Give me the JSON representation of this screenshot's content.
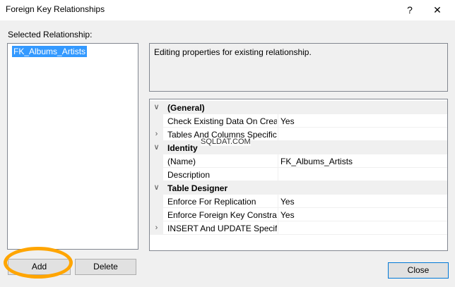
{
  "window": {
    "title": "Foreign Key Relationships",
    "help_label": "?",
    "close_glyph": "✕"
  },
  "relationships": {
    "label": "Selected Relationship:",
    "items": [
      "FK_Albums_Artists"
    ]
  },
  "description": "Editing properties for existing relationship.",
  "properties": {
    "general": {
      "label": "(General)",
      "check_existing": {
        "name": "Check Existing Data On Creati",
        "value": "Yes"
      },
      "tables_columns": {
        "name": "Tables And Columns Specifica",
        "value": ""
      }
    },
    "identity": {
      "label": "Identity",
      "name_prop": {
        "name": "(Name)",
        "value": "FK_Albums_Artists"
      },
      "description_prop": {
        "name": "Description",
        "value": ""
      }
    },
    "table_designer": {
      "label": "Table Designer",
      "enforce_replication": {
        "name": "Enforce For Replication",
        "value": "Yes"
      },
      "enforce_fk": {
        "name": "Enforce Foreign Key Constrair",
        "value": "Yes"
      },
      "insert_update": {
        "name": "INSERT And UPDATE Specifica",
        "value": ""
      }
    }
  },
  "watermark": "SQLDAT.COM",
  "buttons": {
    "add": "Add",
    "delete": "Delete",
    "close": "Close"
  },
  "icons": {
    "expanded": "chevron-down-icon",
    "collapsed": "chevron-right-icon"
  },
  "colors": {
    "selection": "#3399ff",
    "highlight_ring": "#ffa500",
    "default_button_border": "#0078d7"
  }
}
